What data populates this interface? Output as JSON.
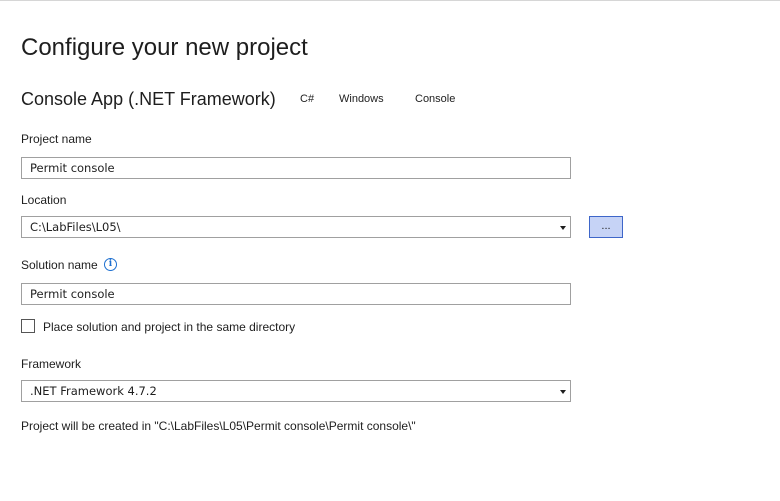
{
  "page": {
    "title": "Configure your new project",
    "template": {
      "name": "Console App (.NET Framework)",
      "tags": [
        "C#",
        "Windows",
        "Console"
      ]
    }
  },
  "form": {
    "project_name": {
      "label": "Project name",
      "value": "Permit console"
    },
    "location": {
      "label": "Location",
      "value": "C:\\LabFiles\\L05\\",
      "browse_label": "..."
    },
    "solution_name": {
      "label": "Solution name",
      "value": "Permit console",
      "info_icon": "i"
    },
    "same_directory": {
      "label": "Place solution and project in the same directory",
      "checked": false
    },
    "framework": {
      "label": "Framework",
      "value": ".NET Framework 4.7.2"
    },
    "summary": "Project will be created in \"C:\\LabFiles\\L05\\Permit console\\Permit console\\\""
  },
  "colors": {
    "browse_button_bg": "#c6d3f6",
    "browse_button_border": "#3e66c9",
    "info_icon": "#1d6fd0"
  }
}
